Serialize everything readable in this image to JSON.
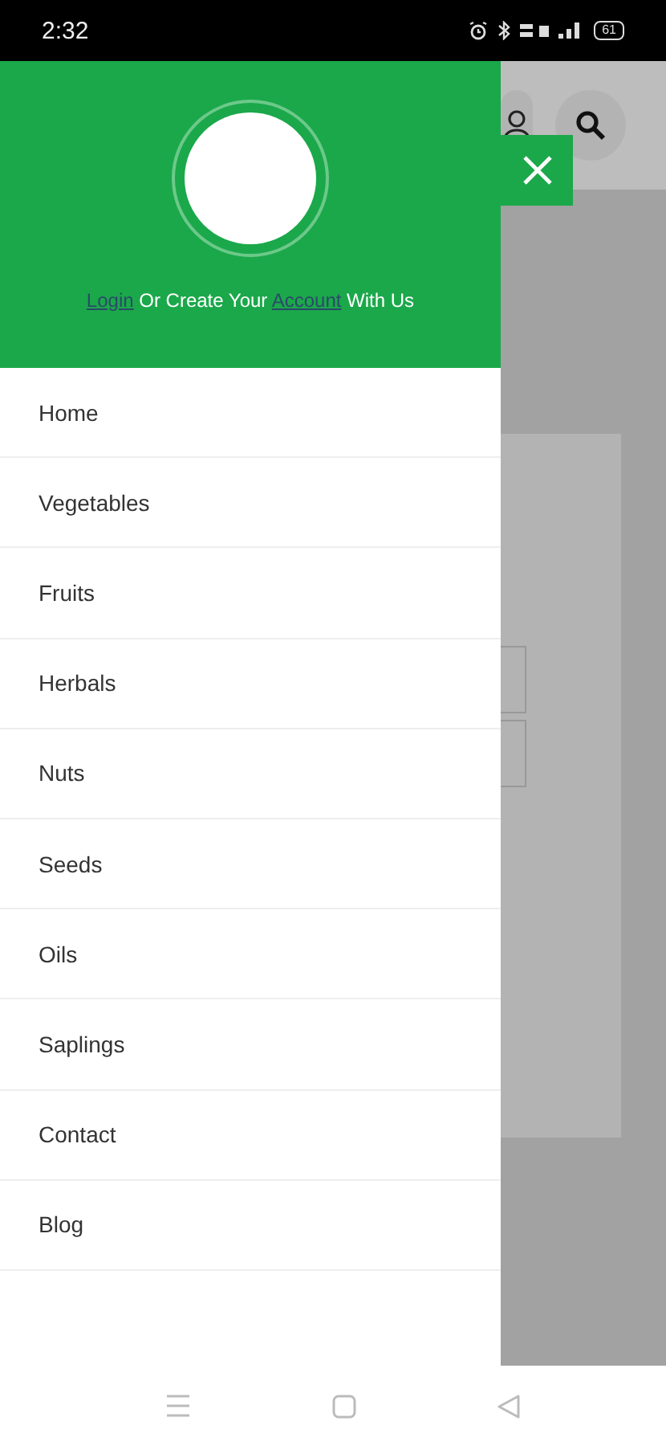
{
  "status_bar": {
    "time": "2:32",
    "battery": "61"
  },
  "drawer": {
    "prompt": [
      {
        "kind": "link",
        "text": "Login"
      },
      {
        "kind": "text",
        "text": " Or Create Your "
      },
      {
        "kind": "link",
        "text": "Account"
      },
      {
        "kind": "text",
        "text": " With Us"
      }
    ],
    "items": [
      {
        "label": "Home"
      },
      {
        "label": "Vegetables"
      },
      {
        "label": "Fruits"
      },
      {
        "label": "Herbals"
      },
      {
        "label": "Nuts"
      },
      {
        "label": "Seeds"
      },
      {
        "label": "Oils"
      },
      {
        "label": "Saplings"
      },
      {
        "label": "Contact"
      },
      {
        "label": "Blog"
      }
    ]
  }
}
